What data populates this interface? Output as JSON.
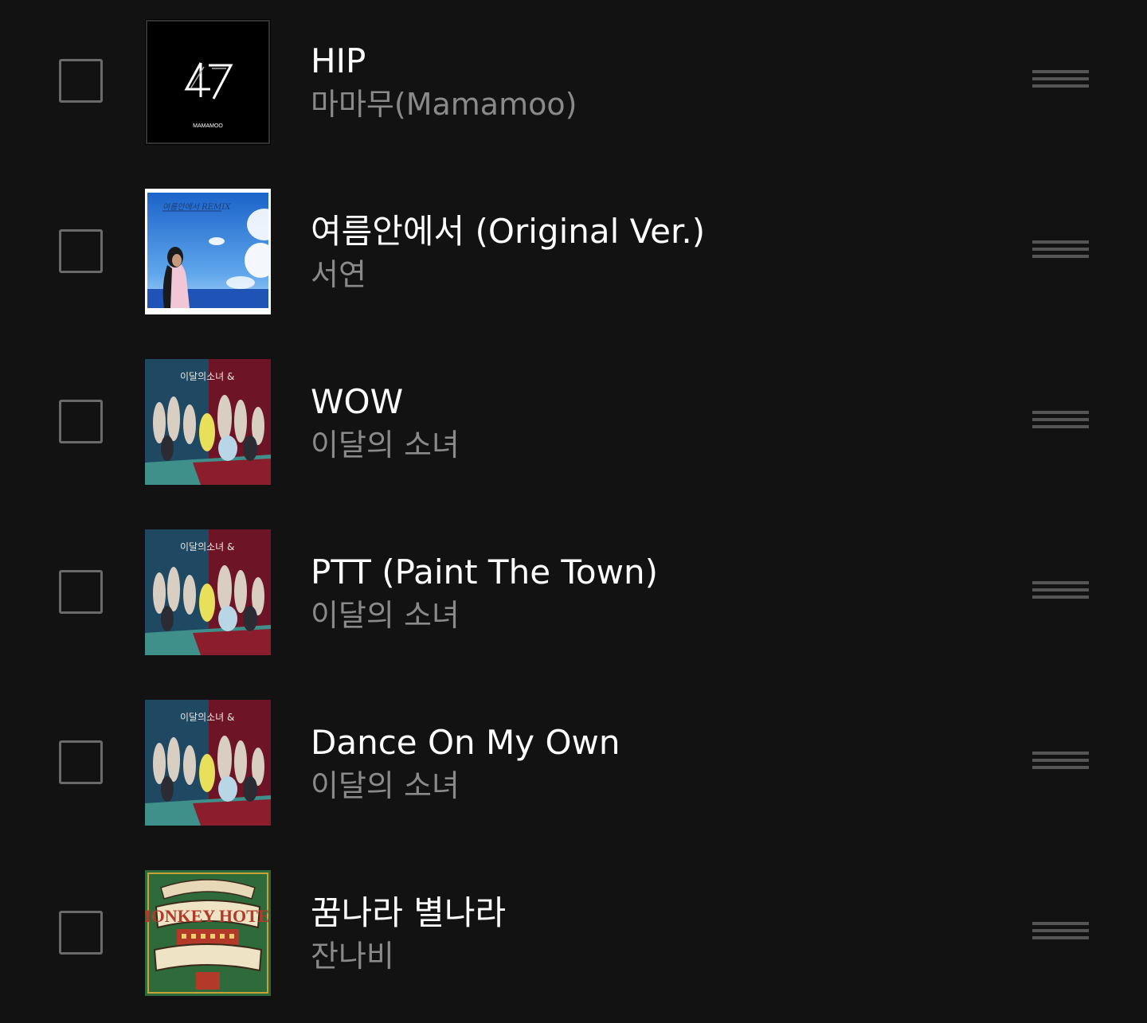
{
  "tracks": [
    {
      "title": "HIP",
      "artist": "마마무(Mamamoo)",
      "selected": false,
      "art_text": "MAMAMOO"
    },
    {
      "title": "여름안에서 (Original Ver.)",
      "artist": "서연",
      "selected": false,
      "art_text": "여름안에서 REMIX"
    },
    {
      "title": "WOW",
      "artist": "이달의 소녀",
      "selected": false,
      "art_text": "이달의소녀 &"
    },
    {
      "title": "PTT (Paint The Town)",
      "artist": "이달의 소녀",
      "selected": false,
      "art_text": "이달의소녀 &"
    },
    {
      "title": "Dance On My Own",
      "artist": "이달의 소녀",
      "selected": false,
      "art_text": "이달의소녀 &"
    },
    {
      "title": "꿈나라 별나라",
      "artist": "잔나비",
      "selected": false,
      "art_text": "MONKEY HOTEL"
    }
  ],
  "icons": {
    "checkbox": "checkbox-icon",
    "drag": "drag-handle-icon"
  },
  "colors": {
    "background": "#121212",
    "title": "#ffffff",
    "artist": "#8a8a8a",
    "checkbox_border": "#6a6a6a",
    "handle": "#555555"
  }
}
